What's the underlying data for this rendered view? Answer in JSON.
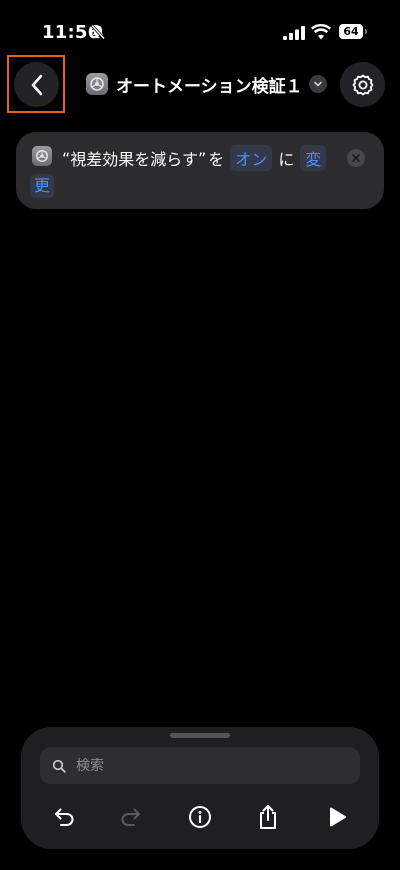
{
  "status_bar": {
    "time": "11:56",
    "battery": "64",
    "icons": [
      "bell-slash-icon",
      "cellular-signal-icon",
      "wifi-icon",
      "battery-icon"
    ]
  },
  "header": {
    "title": "オートメーション検証１",
    "back_icon": "chevron-left-icon",
    "title_chevron_icon": "chevron-down-icon",
    "settings_icon": "settings-gear-icon"
  },
  "action": {
    "quote_open": "“",
    "setting_name": "視差効果を減らす",
    "quote_close": "”",
    "particle_wo": "を",
    "state_value": "オン",
    "particle_ni": "に",
    "verb_part1": "変",
    "verb_part2": "更"
  },
  "bottom_sheet": {
    "search_placeholder": "検索",
    "toolbar": [
      "undo-icon",
      "redo-icon",
      "info-icon",
      "share-icon",
      "play-icon"
    ]
  },
  "colors": {
    "background": "#000000",
    "card": "#2c2c2e",
    "accent": "#4b8ff7",
    "highlight": "#e4621a"
  }
}
